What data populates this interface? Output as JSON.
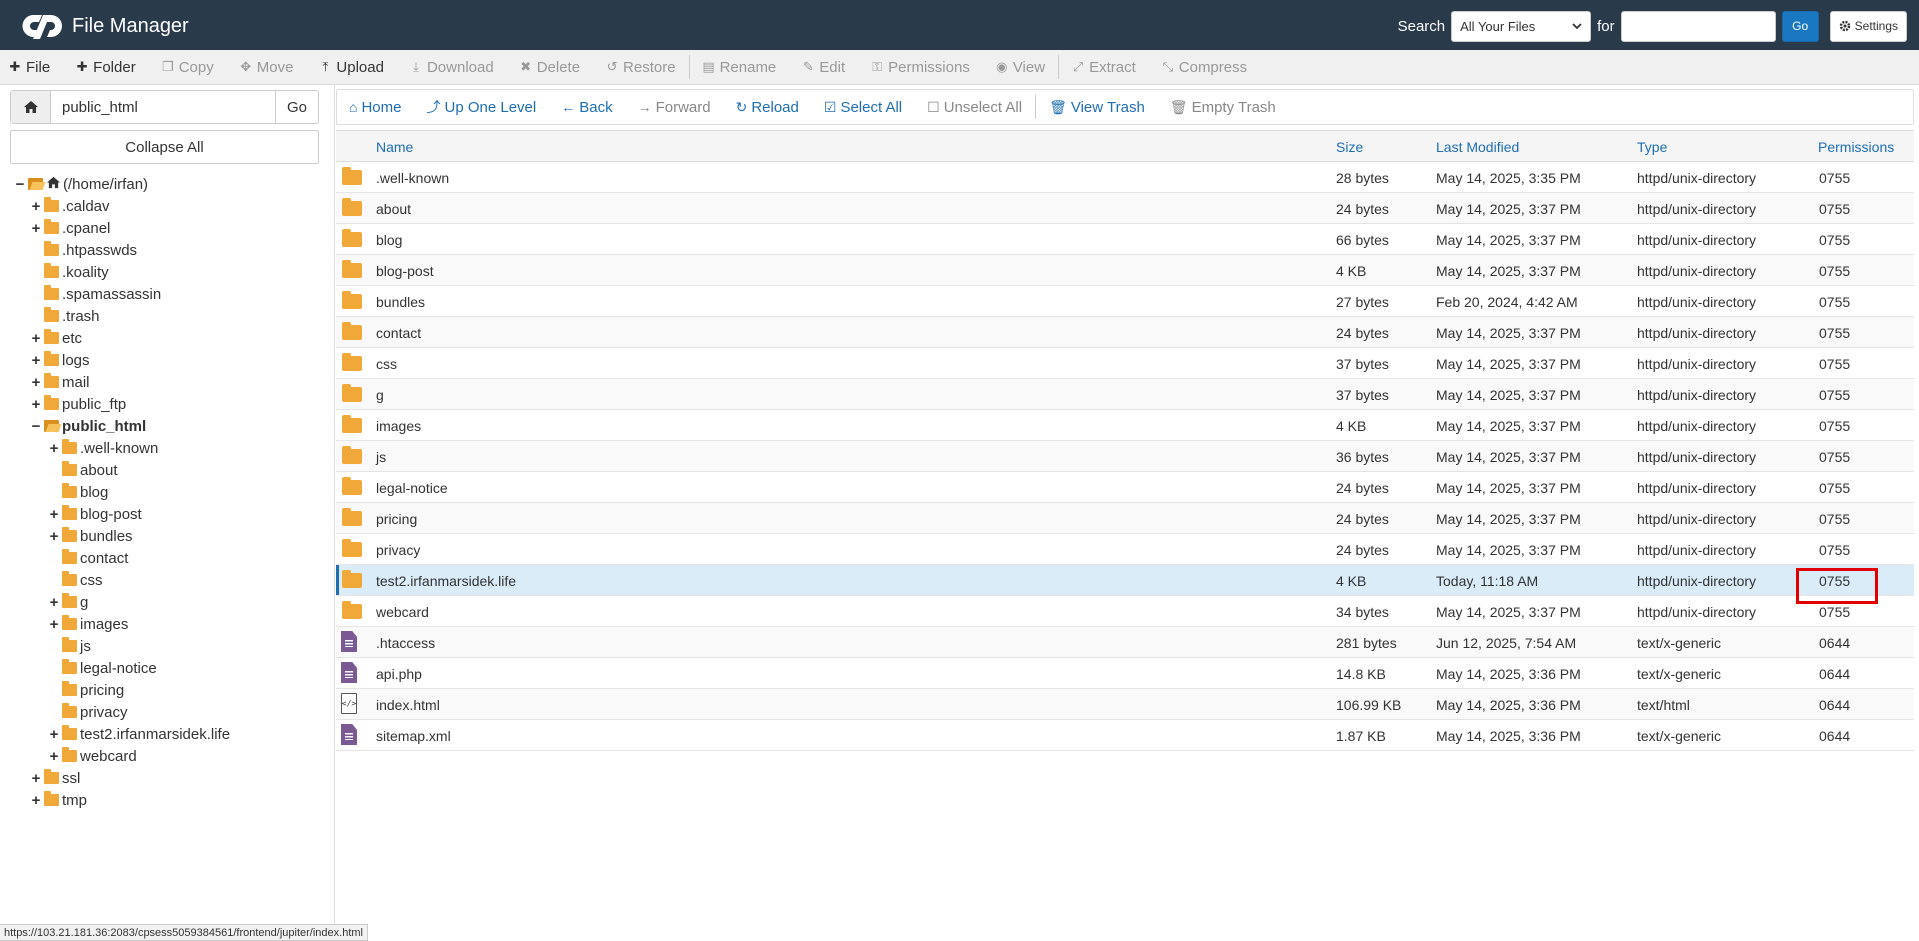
{
  "header": {
    "title": "File Manager",
    "search_label": "Search",
    "search_scope": "All Your Files",
    "for_label": "for",
    "search_placeholder": "",
    "go_label": "Go",
    "settings_label": "Settings"
  },
  "toolbar": {
    "items": [
      {
        "label": "File",
        "icon": "plus-icon",
        "enabled": true
      },
      {
        "label": "Folder",
        "icon": "plus-icon",
        "enabled": true
      },
      {
        "label": "Copy",
        "icon": "copy-icon",
        "enabled": false
      },
      {
        "label": "Move",
        "icon": "move-icon",
        "enabled": false
      },
      {
        "label": "Upload",
        "icon": "upload-icon",
        "enabled": true
      },
      {
        "label": "Download",
        "icon": "download-icon",
        "enabled": false
      },
      {
        "label": "Delete",
        "icon": "close-icon",
        "enabled": false
      },
      {
        "label": "Restore",
        "icon": "undo-icon",
        "enabled": false
      },
      {
        "label": "Rename",
        "icon": "file-icon",
        "enabled": false
      },
      {
        "label": "Edit",
        "icon": "pencil-icon",
        "enabled": false
      },
      {
        "label": "Permissions",
        "icon": "key-icon",
        "enabled": false
      },
      {
        "label": "View",
        "icon": "eye-icon",
        "enabled": false
      },
      {
        "label": "Extract",
        "icon": "expand-icon",
        "enabled": false
      },
      {
        "label": "Compress",
        "icon": "compress-icon",
        "enabled": false
      }
    ]
  },
  "sidebar": {
    "path_value": "public_html",
    "go_label": "Go",
    "collapse_label": "Collapse All",
    "tree": [
      {
        "label": "(/home/irfan)",
        "toggle": "−",
        "level": 0,
        "icon": "home",
        "open": true
      },
      {
        "label": ".caldav",
        "toggle": "+",
        "level": 1
      },
      {
        "label": ".cpanel",
        "toggle": "+",
        "level": 1
      },
      {
        "label": ".htpasswds",
        "toggle": "",
        "level": 1
      },
      {
        "label": ".koality",
        "toggle": "",
        "level": 1
      },
      {
        "label": ".spamassassin",
        "toggle": "",
        "level": 1
      },
      {
        "label": ".trash",
        "toggle": "",
        "level": 1
      },
      {
        "label": "etc",
        "toggle": "+",
        "level": 1
      },
      {
        "label": "logs",
        "toggle": "+",
        "level": 1
      },
      {
        "label": "mail",
        "toggle": "+",
        "level": 1
      },
      {
        "label": "public_ftp",
        "toggle": "+",
        "level": 1
      },
      {
        "label": "public_html",
        "toggle": "−",
        "level": 1,
        "open": true,
        "bold": true
      },
      {
        "label": ".well-known",
        "toggle": "+",
        "level": 2
      },
      {
        "label": "about",
        "toggle": "",
        "level": 2
      },
      {
        "label": "blog",
        "toggle": "",
        "level": 2
      },
      {
        "label": "blog-post",
        "toggle": "+",
        "level": 2
      },
      {
        "label": "bundles",
        "toggle": "+",
        "level": 2
      },
      {
        "label": "contact",
        "toggle": "",
        "level": 2
      },
      {
        "label": "css",
        "toggle": "",
        "level": 2
      },
      {
        "label": "g",
        "toggle": "+",
        "level": 2
      },
      {
        "label": "images",
        "toggle": "+",
        "level": 2
      },
      {
        "label": "js",
        "toggle": "",
        "level": 2
      },
      {
        "label": "legal-notice",
        "toggle": "",
        "level": 2
      },
      {
        "label": "pricing",
        "toggle": "",
        "level": 2
      },
      {
        "label": "privacy",
        "toggle": "",
        "level": 2
      },
      {
        "label": "test2.irfanmarsidek.life",
        "toggle": "+",
        "level": 2
      },
      {
        "label": "webcard",
        "toggle": "+",
        "level": 2
      },
      {
        "label": "ssl",
        "toggle": "+",
        "level": 1
      },
      {
        "label": "tmp",
        "toggle": "+",
        "level": 1
      }
    ]
  },
  "navbar": {
    "items": [
      {
        "label": "Home",
        "icon": "home-icon",
        "enabled": true
      },
      {
        "label": "Up One Level",
        "icon": "level-up-icon",
        "enabled": true
      },
      {
        "label": "Back",
        "icon": "arrow-left-icon",
        "enabled": true
      },
      {
        "label": "Forward",
        "icon": "arrow-right-icon",
        "enabled": false
      },
      {
        "label": "Reload",
        "icon": "refresh-icon",
        "enabled": true
      },
      {
        "label": "Select All",
        "icon": "checkbox-checked-icon",
        "enabled": true
      },
      {
        "label": "Unselect All",
        "icon": "checkbox-empty-icon",
        "enabled": false
      },
      {
        "label": "View Trash",
        "icon": "trash-icon",
        "enabled": true
      },
      {
        "label": "Empty Trash",
        "icon": "trash-icon",
        "enabled": false
      }
    ]
  },
  "table": {
    "headers": [
      "Name",
      "Size",
      "Last Modified",
      "Type",
      "Permissions"
    ],
    "rows": [
      {
        "name": ".well-known",
        "size": "28 bytes",
        "modified": "May 14, 2025, 3:35 PM",
        "type": "httpd/unix-directory",
        "perms": "0755",
        "kind": "folder"
      },
      {
        "name": "about",
        "size": "24 bytes",
        "modified": "May 14, 2025, 3:37 PM",
        "type": "httpd/unix-directory",
        "perms": "0755",
        "kind": "folder"
      },
      {
        "name": "blog",
        "size": "66 bytes",
        "modified": "May 14, 2025, 3:37 PM",
        "type": "httpd/unix-directory",
        "perms": "0755",
        "kind": "folder"
      },
      {
        "name": "blog-post",
        "size": "4 KB",
        "modified": "May 14, 2025, 3:37 PM",
        "type": "httpd/unix-directory",
        "perms": "0755",
        "kind": "folder"
      },
      {
        "name": "bundles",
        "size": "27 bytes",
        "modified": "Feb 20, 2024, 4:42 AM",
        "type": "httpd/unix-directory",
        "perms": "0755",
        "kind": "folder"
      },
      {
        "name": "contact",
        "size": "24 bytes",
        "modified": "May 14, 2025, 3:37 PM",
        "type": "httpd/unix-directory",
        "perms": "0755",
        "kind": "folder"
      },
      {
        "name": "css",
        "size": "37 bytes",
        "modified": "May 14, 2025, 3:37 PM",
        "type": "httpd/unix-directory",
        "perms": "0755",
        "kind": "folder"
      },
      {
        "name": "g",
        "size": "37 bytes",
        "modified": "May 14, 2025, 3:37 PM",
        "type": "httpd/unix-directory",
        "perms": "0755",
        "kind": "folder"
      },
      {
        "name": "images",
        "size": "4 KB",
        "modified": "May 14, 2025, 3:37 PM",
        "type": "httpd/unix-directory",
        "perms": "0755",
        "kind": "folder"
      },
      {
        "name": "js",
        "size": "36 bytes",
        "modified": "May 14, 2025, 3:37 PM",
        "type": "httpd/unix-directory",
        "perms": "0755",
        "kind": "folder"
      },
      {
        "name": "legal-notice",
        "size": "24 bytes",
        "modified": "May 14, 2025, 3:37 PM",
        "type": "httpd/unix-directory",
        "perms": "0755",
        "kind": "folder"
      },
      {
        "name": "pricing",
        "size": "24 bytes",
        "modified": "May 14, 2025, 3:37 PM",
        "type": "httpd/unix-directory",
        "perms": "0755",
        "kind": "folder"
      },
      {
        "name": "privacy",
        "size": "24 bytes",
        "modified": "May 14, 2025, 3:37 PM",
        "type": "httpd/unix-directory",
        "perms": "0755",
        "kind": "folder"
      },
      {
        "name": "test2.irfanmarsidek.life",
        "size": "4 KB",
        "modified": "Today, 11:18 AM",
        "type": "httpd/unix-directory",
        "perms": "0755",
        "kind": "folder",
        "selected": true
      },
      {
        "name": "webcard",
        "size": "34 bytes",
        "modified": "May 14, 2025, 3:37 PM",
        "type": "httpd/unix-directory",
        "perms": "0755",
        "kind": "folder"
      },
      {
        "name": ".htaccess",
        "size": "281 bytes",
        "modified": "Jun 12, 2025, 7:54 AM",
        "type": "text/x-generic",
        "perms": "0644",
        "kind": "file"
      },
      {
        "name": "api.php",
        "size": "14.8 KB",
        "modified": "May 14, 2025, 3:36 PM",
        "type": "text/x-generic",
        "perms": "0644",
        "kind": "file"
      },
      {
        "name": "index.html",
        "size": "106.99 KB",
        "modified": "May 14, 2025, 3:36 PM",
        "type": "text/html",
        "perms": "0644",
        "kind": "html"
      },
      {
        "name": "sitemap.xml",
        "size": "1.87 KB",
        "modified": "May 14, 2025, 3:36 PM",
        "type": "text/x-generic",
        "perms": "0644",
        "kind": "file"
      }
    ]
  },
  "status_url": "https://103.21.181.36:2083/cpsess5059384561/frontend/jupiter/index.html",
  "colors": {
    "header_bg": "#293a4a",
    "link": "#1f6eb3",
    "folder": "#f0a839",
    "selected_row": "#d9ecf8",
    "highlight": "#e00000"
  }
}
